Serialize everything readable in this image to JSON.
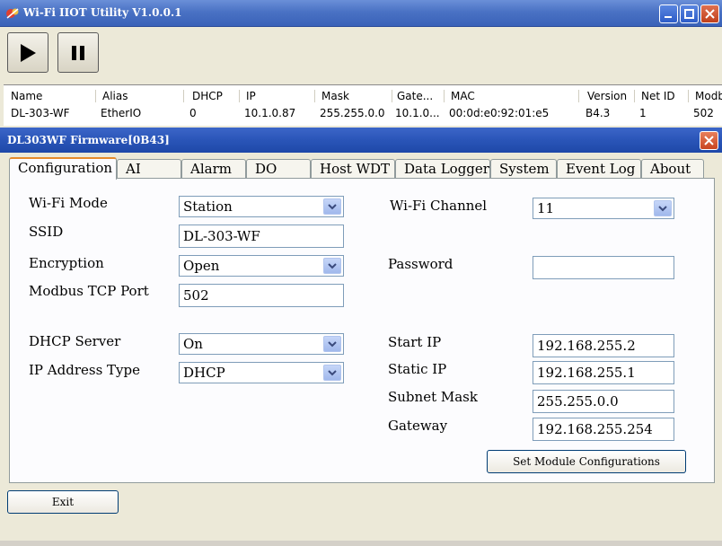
{
  "app": {
    "title": "Wi-Fi IIOT Utility V1.0.0.1"
  },
  "toolbar": {
    "play_icon": "play-icon",
    "pause_icon": "pause-icon"
  },
  "device_list": {
    "columns": [
      "Name",
      "Alias",
      "DHCP",
      "IP",
      "Mask",
      "Gate...",
      "MAC",
      "Version",
      "Net ID",
      "Modb"
    ],
    "rows": [
      [
        "DL-303-WF",
        "EtherIO",
        "0",
        "10.1.0.87",
        "255.255.0.0",
        "10.1.0...",
        "00:0d:e0:92:01:e5",
        "B4.3",
        "1",
        "502"
      ]
    ]
  },
  "dialog": {
    "title": "DL303WF Firmware[0B43]",
    "tabs": [
      "Configuration",
      "AI",
      "Alarm",
      "DO",
      "Host WDT",
      "Data Logger",
      "System",
      "Event Log",
      "About"
    ],
    "active_tab": "Configuration",
    "config": {
      "wifi_mode_label": "Wi-Fi Mode",
      "wifi_mode_value": "Station",
      "ssid_label": "SSID",
      "ssid_value": "DL-303-WF",
      "encryption_label": "Encryption",
      "encryption_value": "Open",
      "modbus_port_label": "Modbus TCP Port",
      "modbus_port_value": "502",
      "dhcp_server_label": "DHCP Server",
      "dhcp_server_value": "On",
      "ip_type_label": "IP Address Type",
      "ip_type_value": "DHCP",
      "wifi_channel_label": "Wi-Fi Channel",
      "wifi_channel_value": "11",
      "password_label": "Password",
      "password_value": "",
      "start_ip_label": "Start IP",
      "start_ip_value": "192.168.255.2",
      "static_ip_label": "Static IP",
      "static_ip_value": "192.168.255.1",
      "subnet_mask_label": "Subnet Mask",
      "subnet_mask_value": "255.255.0.0",
      "gateway_label": "Gateway",
      "gateway_value": "192.168.255.254",
      "set_button": "Set Module Configurations"
    },
    "exit_button": "Exit"
  },
  "colors": {
    "titlebar": "#3a62b8",
    "tab_active_accent": "#e68b2c",
    "field_border": "#7f9db9"
  }
}
